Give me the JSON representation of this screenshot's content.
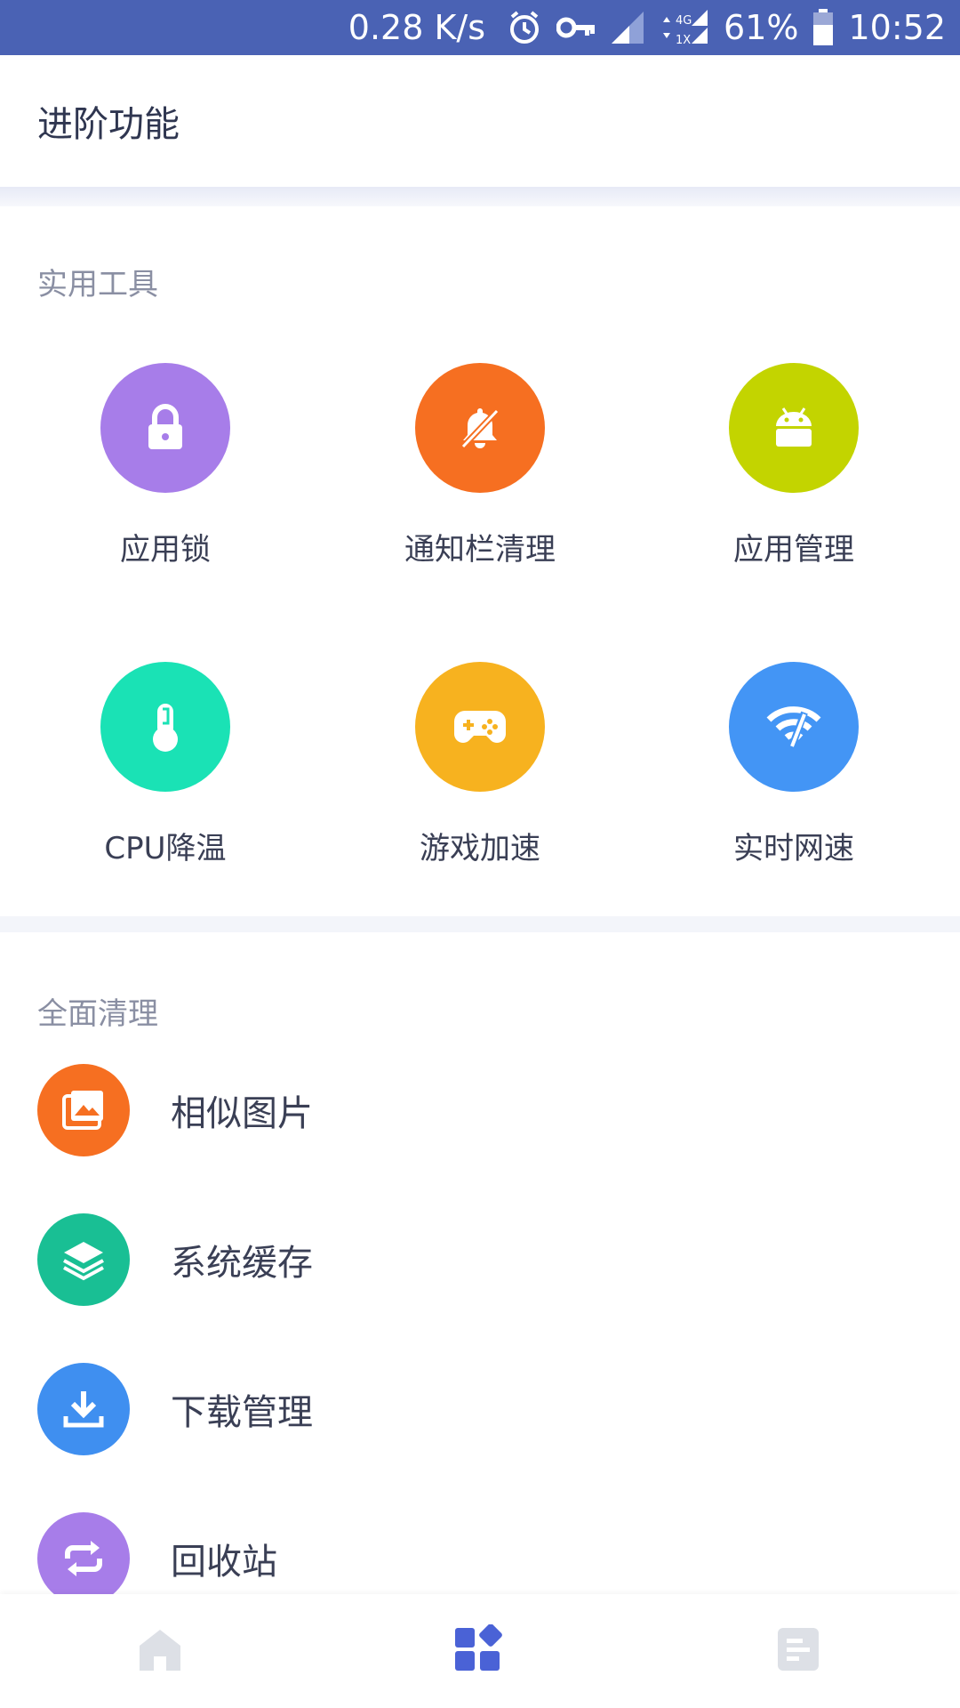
{
  "status_bar": {
    "speed": "0.28 K/s",
    "battery": "61%",
    "time": "10:52",
    "icons": [
      "alarm-icon",
      "vpn-key-icon",
      "signal-icon",
      "data-4g-icon",
      "signal-icon",
      "battery-icon"
    ],
    "background": "#4a62b4"
  },
  "header": {
    "title": "进阶功能"
  },
  "tools_section": {
    "title": "实用工具",
    "items": [
      {
        "label": "应用锁",
        "icon": "lock-icon",
        "color": "#a77de9"
      },
      {
        "label": "通知栏清理",
        "icon": "bell-off-icon",
        "color": "#f66f21"
      },
      {
        "label": "应用管理",
        "icon": "android-icon",
        "color": "#c3d400"
      },
      {
        "label": "CPU降温",
        "icon": "thermometer-icon",
        "color": "#1ae2b5"
      },
      {
        "label": "游戏加速",
        "icon": "gamepad-icon",
        "color": "#f7b21f"
      },
      {
        "label": "实时网速",
        "icon": "wifi-speed-icon",
        "color": "#4395f5"
      }
    ]
  },
  "clean_section": {
    "title": "全面清理",
    "items": [
      {
        "label": "相似图片",
        "icon": "photos-icon",
        "color": "#f66f21"
      },
      {
        "label": "系统缓存",
        "icon": "layers-icon",
        "color": "#19bf94"
      },
      {
        "label": "下载管理",
        "icon": "download-icon",
        "color": "#3f8ff0"
      },
      {
        "label": "回收站",
        "icon": "recycle-icon",
        "color": "#a77de9"
      }
    ]
  },
  "bottom_nav": {
    "items": [
      {
        "icon": "home-icon",
        "active": false
      },
      {
        "icon": "apps-icon",
        "active": true
      },
      {
        "icon": "list-icon",
        "active": false
      }
    ],
    "active_color": "#4a62d6",
    "inactive_color": "#dde0e6"
  }
}
